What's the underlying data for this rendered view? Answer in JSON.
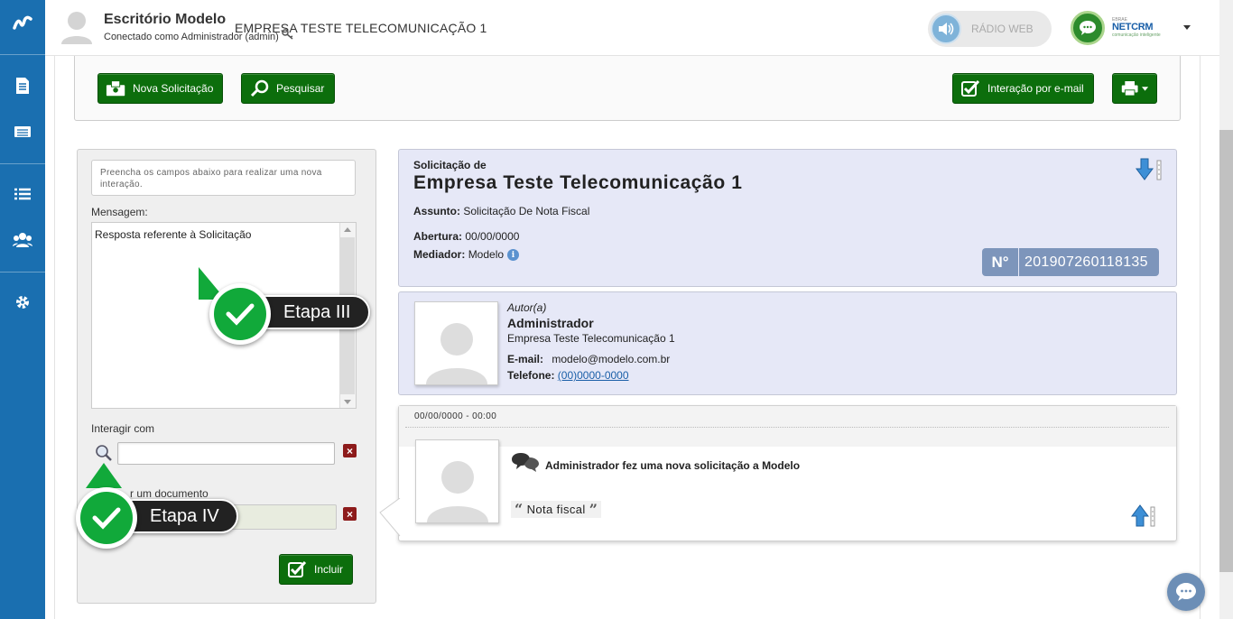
{
  "header": {
    "office_name": "Escritório Modelo",
    "connected_as": "Conectado como Administrador (admin)",
    "company": "EMPRESA TESTE TELECOMUNICAÇÃO 1",
    "radio_label": "RÁDIO WEB",
    "brand": "NETCRM",
    "brand_small": "EBRAE",
    "brand_tag": "comunicação inteligente"
  },
  "sidebar": {
    "items": [
      {
        "icon": "document-icon"
      },
      {
        "icon": "list-card-icon"
      },
      {
        "icon": "list-icon"
      },
      {
        "icon": "users-icon"
      },
      {
        "icon": "gear-icon"
      }
    ]
  },
  "toolbar": {
    "new_request": "Nova Solicitação",
    "search": "Pesquisar",
    "email_interaction": "Interação por e-mail"
  },
  "form": {
    "hint": "Preencha os campos abaixo para realizar uma nova interação.",
    "message_label": "Mensagem:",
    "message_value": "Resposta referente à Solicitação",
    "interact_label": "Interagir com",
    "doc_label": "r um documento",
    "include_button": "Incluir",
    "stage3": "Etapa III",
    "stage4": "Etapa IV"
  },
  "request": {
    "label": "Solicitação de",
    "company": "Empresa Teste Telecomunicação 1",
    "subject_label": "Assunto:",
    "subject": "Solicitação De Nota Fiscal",
    "opening_label": "Abertura:",
    "opening": "00/00/0000",
    "mediator_label": "Mediador:",
    "mediator": "Modelo",
    "number_label": "N°",
    "number": "201907260118135"
  },
  "author": {
    "label": "Autor(a)",
    "name": "Administrador",
    "company": "Empresa Teste Telecomunicação 1",
    "email_label": "E-mail:",
    "email": "modelo@modelo.com.br",
    "phone_label": "Telefone:",
    "phone": "(00)0000-0000"
  },
  "timeline": {
    "timestamp": "00/00/0000 - 00:00",
    "event": "Administrador fez uma nova solicitação a Modelo",
    "quote": "Nota fiscal"
  },
  "colors": {
    "rail": "#1a6fb0",
    "button_green": "#0c6e0c",
    "card_bg": "#e6e8f7",
    "badge": "#7d95bb",
    "stage_green": "#11a93a"
  }
}
